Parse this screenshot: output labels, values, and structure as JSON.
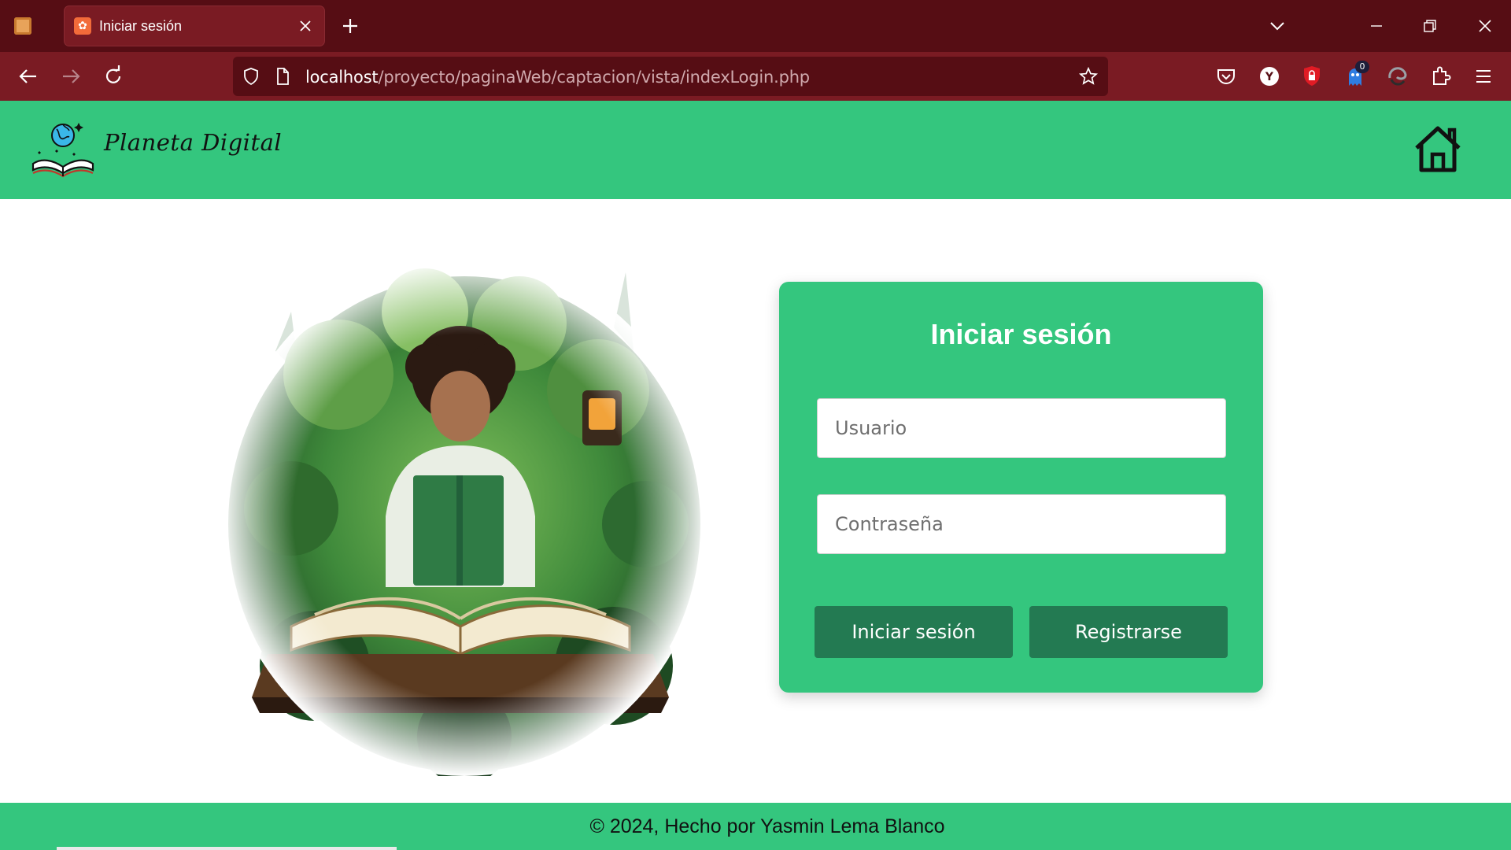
{
  "browser": {
    "tab_title": "Iniciar sesión",
    "url_host": "localhost",
    "url_path": "/proyecto/paginaWeb/captacion/vista/indexLogin.php",
    "extension_badge": "0"
  },
  "header": {
    "brand": "Planeta Digital"
  },
  "login": {
    "title": "Iniciar sesión",
    "username_placeholder": "Usuario",
    "password_placeholder": "Contraseña",
    "login_button": "Iniciar sesión",
    "register_button": "Registrarse"
  },
  "footer": {
    "text": "© 2024, Hecho por Yasmin Lema Blanco"
  },
  "colors": {
    "chrome_dark": "#560d14",
    "chrome": "#7a1b23",
    "brand_green": "#34c67e",
    "button_green": "#237a52"
  },
  "icons": [
    "app-icon",
    "favicon-icon",
    "close-icon",
    "plus-icon",
    "chevron-down-icon",
    "minimize-icon",
    "restore-icon",
    "window-close-icon",
    "back-icon",
    "forward-icon",
    "reload-icon",
    "shield-icon",
    "page-icon",
    "star-icon",
    "pocket-icon",
    "yandex-icon",
    "lock-extension-icon",
    "ghost-extension-icon",
    "edge-extension-icon",
    "puzzle-icon",
    "menu-icon",
    "logo-icon",
    "home-icon"
  ]
}
